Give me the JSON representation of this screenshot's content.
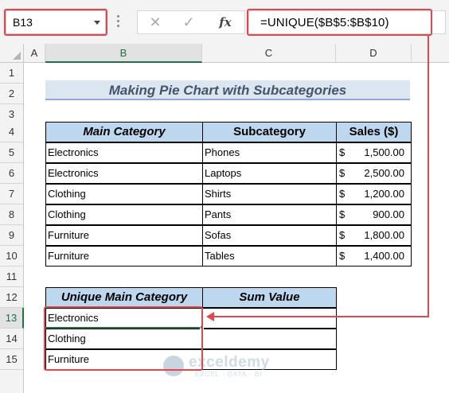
{
  "formula_bar": {
    "name_box": "B13",
    "cancel_icon": "✕",
    "enter_icon": "✓",
    "fx_label": "fx",
    "formula": "=UNIQUE($B$5:$B$10)"
  },
  "columns": [
    "A",
    "B",
    "C",
    "D"
  ],
  "active_column": "B",
  "rows": [
    "1",
    "2",
    "3",
    "4",
    "5",
    "6",
    "7",
    "8",
    "9",
    "10",
    "11",
    "12",
    "13",
    "14",
    "15"
  ],
  "active_row": "13",
  "sheet": {
    "title": "Making Pie Chart with Subcategories",
    "table1": {
      "headers": [
        "Main Category",
        "Subcategory",
        "Sales ($)"
      ],
      "rows": [
        {
          "main": "Electronics",
          "sub": "Phones",
          "cur": "$",
          "sales": "1,500.00"
        },
        {
          "main": "Electronics",
          "sub": "Laptops",
          "cur": "$",
          "sales": "2,500.00"
        },
        {
          "main": "Clothing",
          "sub": "Shirts",
          "cur": "$",
          "sales": "1,200.00"
        },
        {
          "main": "Clothing",
          "sub": "Pants",
          "cur": "$",
          "sales": "900.00"
        },
        {
          "main": "Furniture",
          "sub": "Sofas",
          "cur": "$",
          "sales": "1,800.00"
        },
        {
          "main": "Furniture",
          "sub": "Tables",
          "cur": "$",
          "sales": "1,400.00"
        }
      ]
    },
    "table2": {
      "headers": [
        "Unique Main Category",
        "Sum Value"
      ],
      "rows": [
        {
          "main": "Electronics",
          "sum": ""
        },
        {
          "main": "Clothing",
          "sum": ""
        },
        {
          "main": "Furniture",
          "sum": ""
        }
      ]
    }
  },
  "watermark": {
    "name": "exceldemy",
    "tagline": "EXCEL · DATA · BI"
  },
  "colors": {
    "annotation_red": "#e2474f",
    "header_fill": "#bdd7ee",
    "title_fill": "#dce6f1",
    "excel_green": "#217346"
  }
}
